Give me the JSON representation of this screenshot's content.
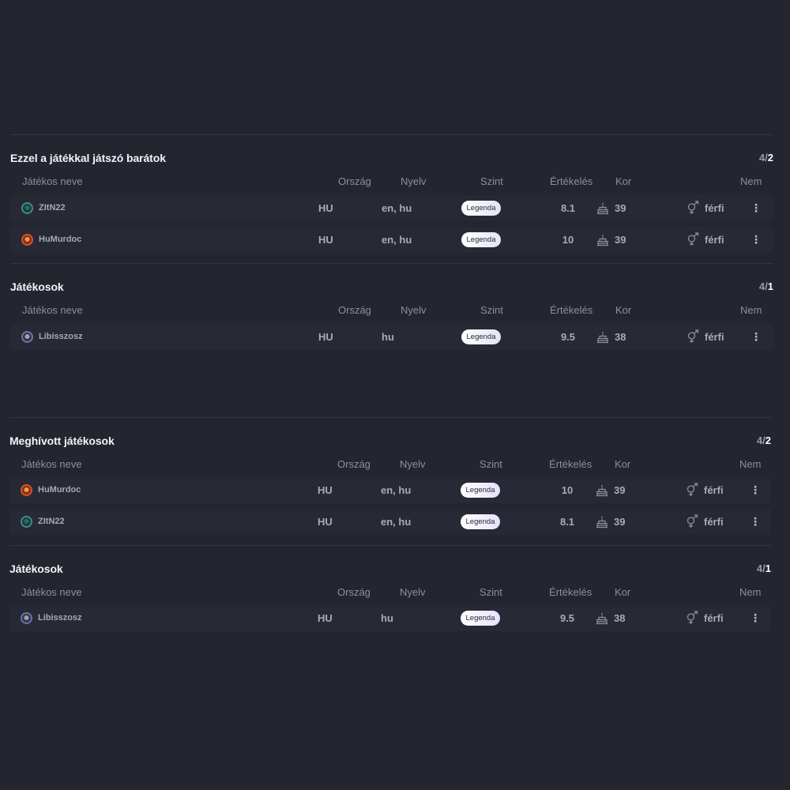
{
  "headers": {
    "name": "Játékos neve",
    "country": "Ország",
    "language": "Nyelv",
    "level": "Szint",
    "rating": "Értékelés",
    "age": "Kor",
    "gender": "Nem"
  },
  "sections": [
    {
      "title": "Ezzel a játékkal játszó barátok",
      "count_prefix": "4/",
      "count_value": "2",
      "rows": [
        {
          "name": "ZItN22",
          "country": "HU",
          "languages": "en, hu",
          "level": "Legenda",
          "rating": "8.1",
          "age": "39",
          "gender": "férfi",
          "avatar": "teal-avatar"
        },
        {
          "name": "HuMurdoc",
          "country": "HU",
          "languages": "en, hu",
          "level": "Legenda",
          "rating": "10",
          "age": "39",
          "gender": "férfi",
          "avatar": "orange-avatar"
        }
      ]
    },
    {
      "title": "Játékosok",
      "count_prefix": "4/",
      "count_value": "1",
      "rows": [
        {
          "name": "Libisszosz",
          "country": "HU",
          "languages": "hu",
          "level": "Legenda",
          "rating": "9.5",
          "age": "38",
          "gender": "férfi",
          "avatar": "blue-avatar"
        }
      ]
    },
    {
      "title": "Meghívott játékosok",
      "count_prefix": "4/",
      "count_value": "2",
      "rows": [
        {
          "name": "HuMurdoc",
          "country": "HU",
          "languages": "en, hu",
          "level": "Legenda",
          "rating": "10",
          "age": "39",
          "gender": "férfi",
          "avatar": "orange-avatar"
        },
        {
          "name": "ZItN22",
          "country": "HU",
          "languages": "en, hu",
          "level": "Legenda",
          "rating": "8.1",
          "age": "39",
          "gender": "férfi",
          "avatar": "teal-avatar"
        }
      ]
    },
    {
      "title": "Játékosok",
      "count_prefix": "4/",
      "count_value": "1",
      "rows": [
        {
          "name": "Libisszosz",
          "country": "HU",
          "languages": "hu",
          "level": "Legenda",
          "rating": "9.5",
          "age": "38",
          "gender": "férfi",
          "avatar": "blue-avatar"
        }
      ]
    }
  ],
  "icons": {
    "age": "cake-icon",
    "gender": "gender-icon",
    "menu": "more-vertical-icon"
  },
  "colors": {
    "background": "#23252f",
    "row": "#272a34",
    "badge": "#f1efff"
  }
}
